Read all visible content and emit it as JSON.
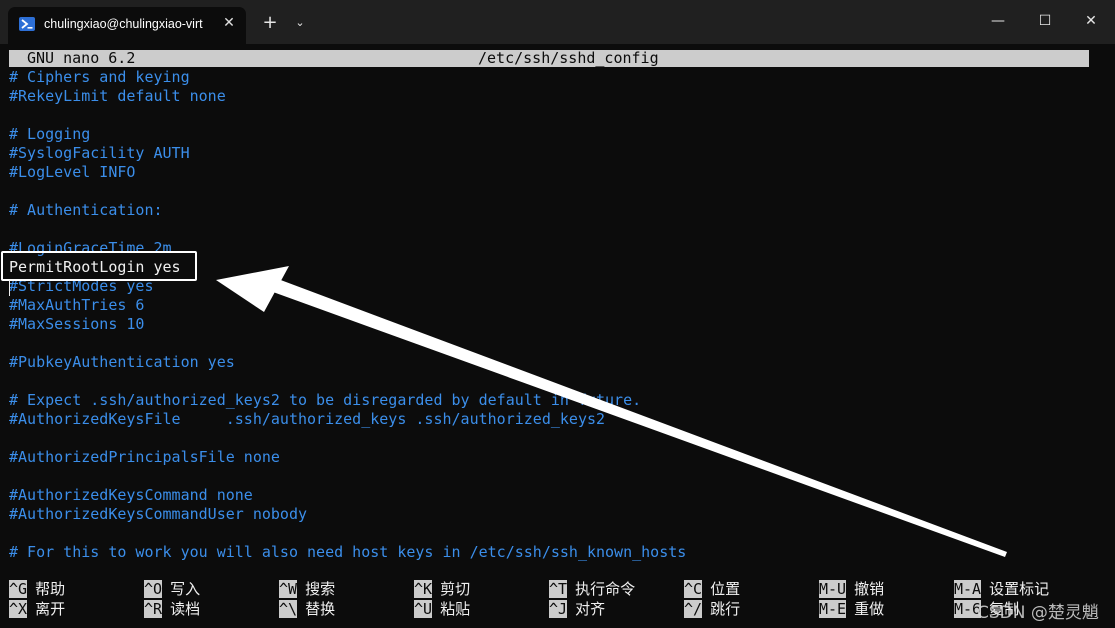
{
  "window": {
    "tab_title": "chulingxiao@chulingxiao-virt",
    "tab_close": "✕",
    "new_tab": "+",
    "dropdown": "⌄",
    "minimize": "—",
    "maximize": "☐",
    "close": "✕"
  },
  "nano": {
    "version": "GNU nano 6.2",
    "filename": "/etc/ssh/sshd_config"
  },
  "lines": [
    {
      "text": "# Ciphers and keying",
      "style": "comment"
    },
    {
      "text": "#RekeyLimit default none",
      "style": "comment"
    },
    {
      "text": "",
      "style": "comment"
    },
    {
      "text": "# Logging",
      "style": "comment"
    },
    {
      "text": "#SyslogFacility AUTH",
      "style": "comment"
    },
    {
      "text": "#LogLevel INFO",
      "style": "comment"
    },
    {
      "text": "",
      "style": "comment"
    },
    {
      "text": "# Authentication:",
      "style": "comment"
    },
    {
      "text": "",
      "style": "comment"
    },
    {
      "text": "#LoginGraceTime 2m",
      "style": "comment"
    },
    {
      "text": "PermitRootLogin yes",
      "style": "plain"
    },
    {
      "text": "#StrictModes yes",
      "style": "comment"
    },
    {
      "text": "#MaxAuthTries 6",
      "style": "comment"
    },
    {
      "text": "#MaxSessions 10",
      "style": "comment"
    },
    {
      "text": "",
      "style": "comment"
    },
    {
      "text": "#PubkeyAuthentication yes",
      "style": "comment"
    },
    {
      "text": "",
      "style": "comment"
    },
    {
      "text": "# Expect .ssh/authorized_keys2 to be disregarded by default in future.",
      "style": "comment"
    },
    {
      "text": "#AuthorizedKeysFile     .ssh/authorized_keys .ssh/authorized_keys2",
      "style": "comment"
    },
    {
      "text": "",
      "style": "comment"
    },
    {
      "text": "#AuthorizedPrincipalsFile none",
      "style": "comment"
    },
    {
      "text": "",
      "style": "comment"
    },
    {
      "text": "#AuthorizedKeysCommand none",
      "style": "comment"
    },
    {
      "text": "#AuthorizedKeysCommandUser nobody",
      "style": "comment"
    },
    {
      "text": "",
      "style": "comment"
    },
    {
      "text": "# For this to work you will also need host keys in /etc/ssh/ssh_known_hosts",
      "style": "comment"
    }
  ],
  "shortcuts": [
    {
      "key": "^G",
      "label": "帮助"
    },
    {
      "key": "^O",
      "label": "写入"
    },
    {
      "key": "^W",
      "label": "搜索"
    },
    {
      "key": "^K",
      "label": "剪切"
    },
    {
      "key": "^T",
      "label": "执行命令"
    },
    {
      "key": "^C",
      "label": "位置"
    },
    {
      "key": "M-U",
      "label": "撤销"
    },
    {
      "key": "M-A",
      "label": "设置标记"
    },
    {
      "key": "^X",
      "label": "离开"
    },
    {
      "key": "^R",
      "label": "读档"
    },
    {
      "key": "^\\",
      "label": "替换"
    },
    {
      "key": "^U",
      "label": "粘贴"
    },
    {
      "key": "^J",
      "label": "对齐"
    },
    {
      "key": "^/",
      "label": "跳行"
    },
    {
      "key": "M-E",
      "label": "重做"
    },
    {
      "key": "M-6",
      "label": "复制"
    }
  ],
  "watermark": "CSDN @楚灵魈",
  "colors": {
    "comment": "#3b8eea",
    "plain": "#f0f0f0",
    "background": "#0c0c0c",
    "inverse": "#cccccc"
  }
}
